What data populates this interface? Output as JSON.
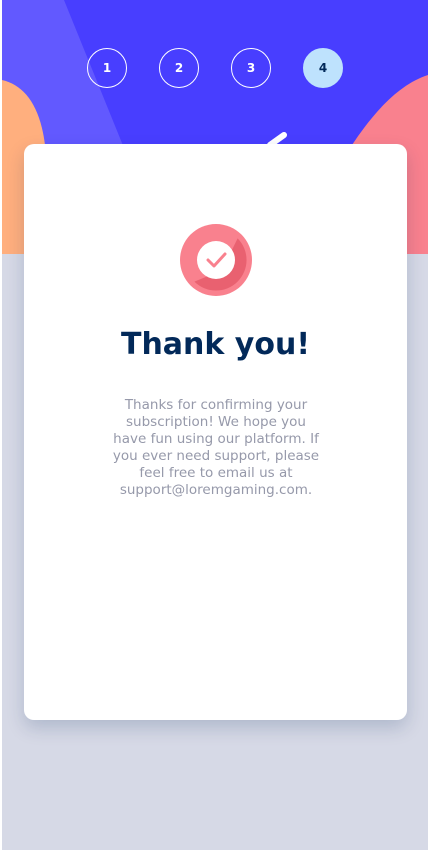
{
  "steps": [
    {
      "label": "1",
      "active": false
    },
    {
      "label": "2",
      "active": false
    },
    {
      "label": "3",
      "active": false
    },
    {
      "label": "4",
      "active": true
    }
  ],
  "confirmation": {
    "icon": "checkmark-icon",
    "title": "Thank you!",
    "message": "Thanks for confirming your subscription! We hope you have fun using our platform. If you ever need support, please feel free to email us at support@loremgaming.com."
  },
  "colors": {
    "hero_background": "#483eff",
    "page_background": "#d6d9e6",
    "active_step_fill": "#bee2fd",
    "title_text": "#022959",
    "body_text": "#9699aa",
    "icon_accent": "#f9818e"
  }
}
